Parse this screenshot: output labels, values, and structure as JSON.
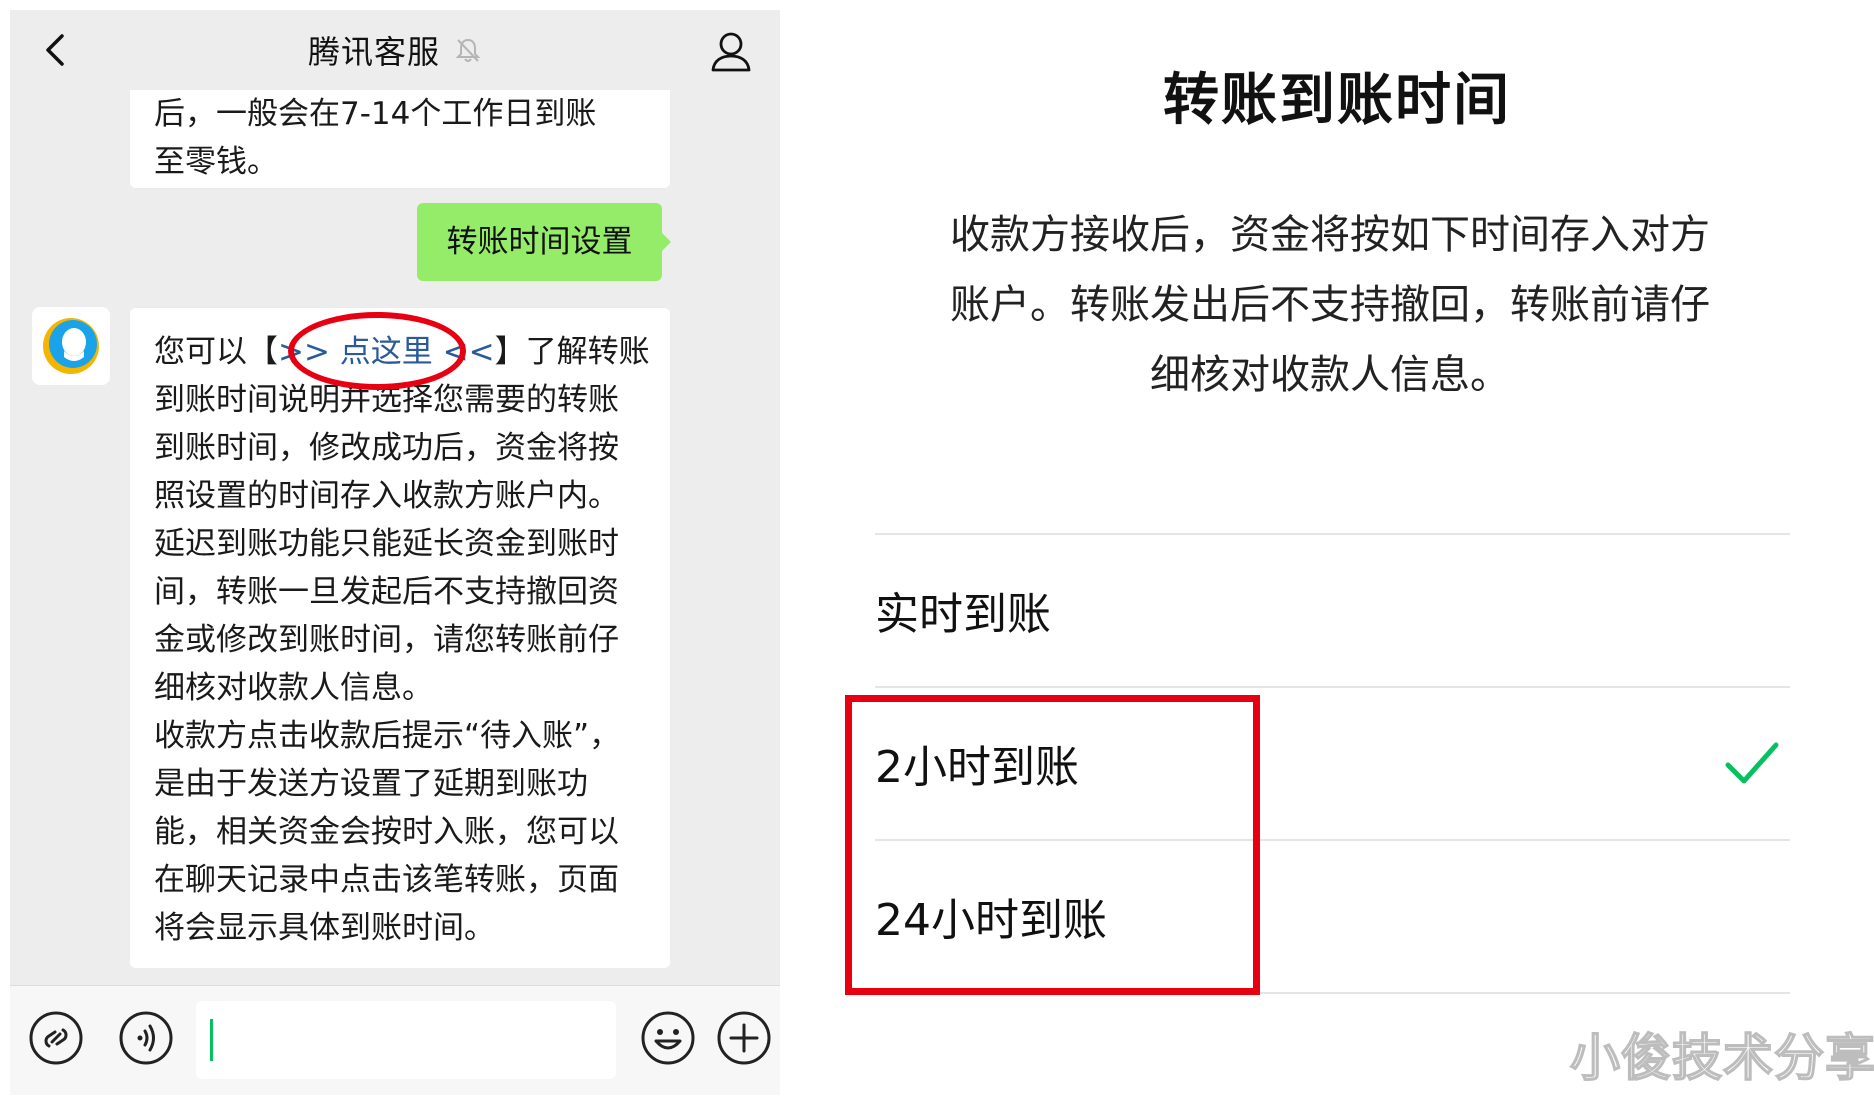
{
  "chat": {
    "title": "腾讯客服",
    "prev_message_lines": [
      "后，一般会在7-14个工作日到账",
      "至零钱。"
    ],
    "sent_message": "转账时间设置",
    "reply": {
      "line1_prefix": "您可以【",
      "line1_link": ">> 点这里 <<",
      "line1_suffix": "】了解转账",
      "lines": [
        "到账时间说明并选择您需要的转账",
        "到账时间，修改成功后，资金将按",
        "照设置的时间存入收款方账户内。",
        "延迟到账功能只能延长资金到账时",
        "间，转账一旦发起后不支持撤回资",
        "金或修改到账时间，请您转账前仔",
        "细核对收款人信息。",
        "收款方点击收款后提示“待入账”，",
        "是由于发送方设置了延期到账功",
        "能，相关资金会按时入账，您可以",
        "在聊天记录中点击该笔转账，页面",
        "将会显示具体到账时间。"
      ]
    },
    "colors": {
      "sent_bubble": "#95ec69",
      "link": "#2b5a9a",
      "annotation": "#e60012",
      "caret": "#07c160"
    }
  },
  "settings": {
    "title": "转账到账时间",
    "description_lines": [
      "收款方接收后，资金将按如下时间存入对方",
      "账户。转账发出后不支持撤回，转账前请仔",
      "细核对收款人信息。"
    ],
    "options": [
      {
        "label": "实时到账",
        "selected": false
      },
      {
        "label": "2小时到账",
        "selected": true
      },
      {
        "label": "24小时到账",
        "selected": false
      }
    ],
    "check_color": "#07c160"
  },
  "watermark": "小俊技术分享"
}
